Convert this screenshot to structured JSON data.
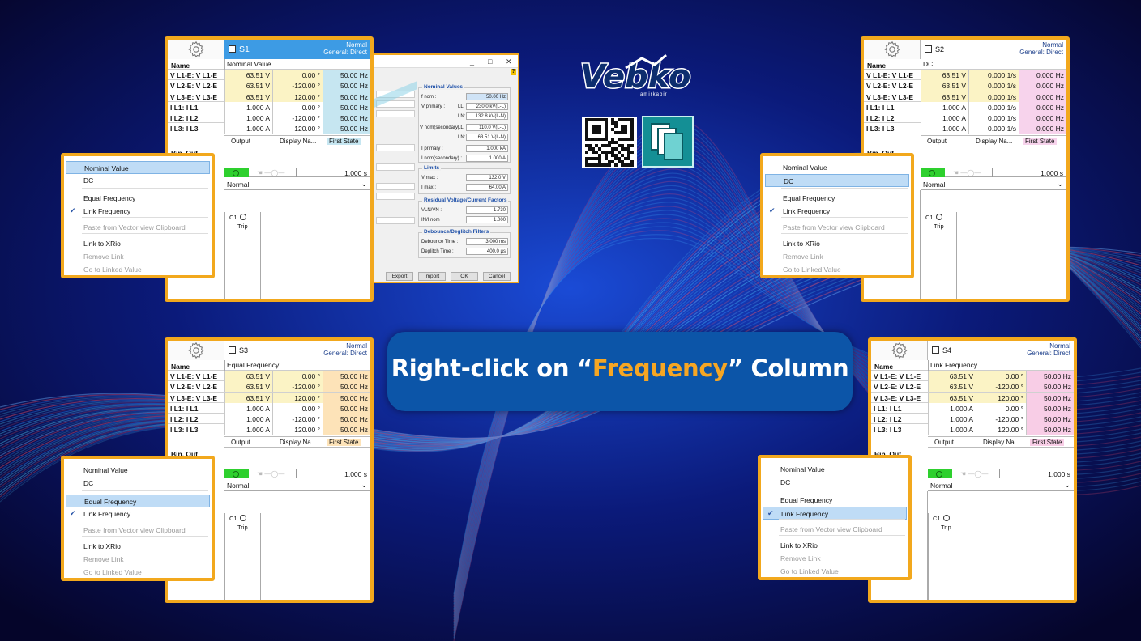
{
  "banner": {
    "prefix": "Right-click on “",
    "highlight": "Frequency",
    "suffix": "” Column"
  },
  "brand": {
    "name": "Vebko",
    "tagline": "amirkabir"
  },
  "panels": [
    {
      "id": "S1",
      "sname": "S1",
      "mode_top": "Normal",
      "mode_bottom": "General: Direct",
      "subtitle": "Nominal Value",
      "name_header": "Name",
      "rows": [
        {
          "name": "V L1-E: V L1-E",
          "mag": "63.51 V",
          "ang": "0.00 °",
          "freq": "50.00 Hz"
        },
        {
          "name": "V L2-E: V L2-E",
          "mag": "63.51 V",
          "ang": "-120.00 °",
          "freq": "50.00 Hz"
        },
        {
          "name": "V L3-E: V L3-E",
          "mag": "63.51 V",
          "ang": "120.00 °",
          "freq": "50.00 Hz"
        },
        {
          "name": "I L1: I L1",
          "mag": "1.000 A",
          "ang": "0.00 °",
          "freq": "50.00 Hz"
        },
        {
          "name": "I L2: I L2",
          "mag": "1.000 A",
          "ang": "-120.00 °",
          "freq": "50.00 Hz"
        },
        {
          "name": "I L3: I L3",
          "mag": "1.000 A",
          "ang": "120.00 °",
          "freq": "50.00 Hz"
        }
      ],
      "tabs": [
        "Output",
        "Display Na...",
        "First State"
      ],
      "bin_out": "Bin. Out",
      "duration": "1.000 s",
      "normal": "Normal",
      "c1": "C1",
      "trip": "Trip",
      "freq_color": "#c6e6f1"
    },
    {
      "id": "S2",
      "sname": "S2",
      "mode_top": "Normal",
      "mode_bottom": "General: Direct",
      "subtitle": "DC",
      "name_header": "Name",
      "rows": [
        {
          "name": "V L1-E: V L1-E",
          "mag": "63.51 V",
          "ang": "0.000 1/s",
          "freq": "0.000 Hz"
        },
        {
          "name": "V L2-E: V L2-E",
          "mag": "63.51 V",
          "ang": "0.000 1/s",
          "freq": "0.000 Hz"
        },
        {
          "name": "V L3-E: V L3-E",
          "mag": "63.51 V",
          "ang": "0.000 1/s",
          "freq": "0.000 Hz"
        },
        {
          "name": "I L1: I L1",
          "mag": "1.000 A",
          "ang": "0.000 1/s",
          "freq": "0.000 Hz"
        },
        {
          "name": "I L2: I L2",
          "mag": "1.000 A",
          "ang": "0.000 1/s",
          "freq": "0.000 Hz"
        },
        {
          "name": "I L3: I L3",
          "mag": "1.000 A",
          "ang": "0.000 1/s",
          "freq": "0.000 Hz"
        }
      ],
      "tabs": [
        "Output",
        "Display Na...",
        "First State"
      ],
      "bin_out": "Bin. Out",
      "duration": "1.000 s",
      "normal": "Normal",
      "c1": "C1",
      "trip": "Trip",
      "freq_color": "#f7d3ec"
    },
    {
      "id": "S3",
      "sname": "S3",
      "mode_top": "Normal",
      "mode_bottom": "General: Direct",
      "subtitle": "Equal Frequency",
      "name_header": "Name",
      "rows": [
        {
          "name": "V L1-E: V L1-E",
          "mag": "63.51 V",
          "ang": "0.00 °",
          "freq": "50.00 Hz"
        },
        {
          "name": "V L2-E: V L2-E",
          "mag": "63.51 V",
          "ang": "-120.00 °",
          "freq": "50.00 Hz"
        },
        {
          "name": "V L3-E: V L3-E",
          "mag": "63.51 V",
          "ang": "120.00 °",
          "freq": "50.00 Hz"
        },
        {
          "name": "I L1: I L1",
          "mag": "1.000 A",
          "ang": "0.00 °",
          "freq": "50.00 Hz"
        },
        {
          "name": "I L2: I L2",
          "mag": "1.000 A",
          "ang": "-120.00 °",
          "freq": "50.00 Hz"
        },
        {
          "name": "I L3: I L3",
          "mag": "1.000 A",
          "ang": "120.00 °",
          "freq": "50.00 Hz"
        }
      ],
      "tabs": [
        "Output",
        "Display Na...",
        "First State"
      ],
      "bin_out": "Bin. Out",
      "duration": "1.000 s",
      "normal": "Normal",
      "c1": "C1",
      "trip": "Trip",
      "freq_color": "#fde3b8"
    },
    {
      "id": "S4",
      "sname": "S4",
      "mode_top": "Normal",
      "mode_bottom": "General: Direct",
      "subtitle": "Link Frequency",
      "name_header": "Name",
      "rows": [
        {
          "name": "V L1-E: V L1-E",
          "mag": "63.51 V",
          "ang": "0.00 °",
          "freq": "50.00 Hz"
        },
        {
          "name": "V L2-E: V L2-E",
          "mag": "63.51 V",
          "ang": "-120.00 °",
          "freq": "50.00 Hz"
        },
        {
          "name": "V L3-E: V L3-E",
          "mag": "63.51 V",
          "ang": "120.00 °",
          "freq": "50.00 Hz"
        },
        {
          "name": "I L1: I L1",
          "mag": "1.000 A",
          "ang": "0.00 °",
          "freq": "50.00 Hz"
        },
        {
          "name": "I L2: I L2",
          "mag": "1.000 A",
          "ang": "-120.00 °",
          "freq": "50.00 Hz"
        },
        {
          "name": "I L3: I L3",
          "mag": "1.000 A",
          "ang": "120.00 °",
          "freq": "50.00 Hz"
        }
      ],
      "tabs": [
        "Output",
        "Display Na...",
        "First State"
      ],
      "bin_out": "Bin. Out",
      "duration": "1.000 s",
      "normal": "Normal",
      "c1": "C1",
      "trip": "Trip",
      "freq_color": "#f8cde6"
    }
  ],
  "context_menu": {
    "items": [
      "Nominal Value",
      "DC",
      "Equal Frequency",
      "Link Frequency",
      "Paste from Vector view Clipboard",
      "Link to XRio",
      "Remove Link",
      "Go to Linked Value"
    ],
    "selected_by_menu": [
      "Nominal Value",
      "DC",
      "Equal Frequency",
      "Link Frequency"
    ]
  },
  "dialog": {
    "controls": [
      "_",
      "□",
      "✕"
    ],
    "help": "?",
    "nominal_title": "Nominal Values",
    "fnom_label": "f nom :",
    "fnom": "50.00 Hz",
    "vprimary_label": "V primary :",
    "ll_label": "LL:",
    "vprim_ll": "230.0 kV(L-L)",
    "ln_label": "LN:",
    "vprim_ln": "132.8 kV(L-N)",
    "vsec_label": "V nom(secondary) :",
    "vsec_ll": "110.0 V(L-L)",
    "vsec_ln": "63.51 V(L-N)",
    "iprim_label": "I primary :",
    "iprim": "1.000 kA",
    "isec_label": "I nom(secondary) :",
    "isec": "1.000 A",
    "limits_title": "Limits",
    "vmax_label": "V max :",
    "vmax": "132.0 V",
    "imax_label": "I max :",
    "imax": "64.00 A",
    "resid_title": "Residual Voltage/Current Factors",
    "vln_label": "VLN/VN :",
    "vln": "1.730",
    "iin_label": "IN/I nom",
    "iin": "1.000",
    "debounce_title": "Debounce/Deglitch Filters",
    "deb_label": "Debounce Time :",
    "deb": "3.000 ms",
    "degl_label": "Deglitch Time :",
    "degl": "400.0 µs",
    "buttons": [
      "Export",
      "Import",
      "OK",
      "Cancel"
    ]
  }
}
